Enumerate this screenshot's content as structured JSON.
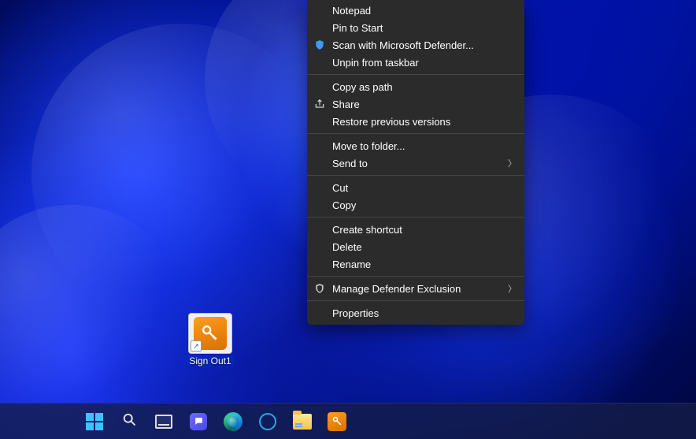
{
  "desktop": {
    "shortcut": {
      "label": "Sign Out1"
    }
  },
  "context_menu": {
    "groups": [
      [
        {
          "label": "Notepad",
          "icon": null,
          "submenu": false
        },
        {
          "label": "Pin to Start",
          "icon": null,
          "submenu": false
        },
        {
          "label": "Scan with Microsoft Defender...",
          "icon": "shield-icon",
          "submenu": false
        },
        {
          "label": "Unpin from taskbar",
          "icon": null,
          "submenu": false
        }
      ],
      [
        {
          "label": "Copy as path",
          "icon": null,
          "submenu": false
        },
        {
          "label": "Share",
          "icon": "share-icon",
          "submenu": false
        },
        {
          "label": "Restore previous versions",
          "icon": null,
          "submenu": false
        }
      ],
      [
        {
          "label": "Move to folder...",
          "icon": null,
          "submenu": false
        },
        {
          "label": "Send to",
          "icon": null,
          "submenu": true
        }
      ],
      [
        {
          "label": "Cut",
          "icon": null,
          "submenu": false
        },
        {
          "label": "Copy",
          "icon": null,
          "submenu": false
        }
      ],
      [
        {
          "label": "Create shortcut",
          "icon": null,
          "submenu": false
        },
        {
          "label": "Delete",
          "icon": null,
          "submenu": false
        },
        {
          "label": "Rename",
          "icon": null,
          "submenu": false
        }
      ],
      [
        {
          "label": "Manage Defender Exclusion",
          "icon": "defender-icon",
          "submenu": true
        }
      ],
      [
        {
          "label": "Properties",
          "icon": null,
          "submenu": false
        }
      ]
    ]
  },
  "taskbar": {
    "items": [
      {
        "name": "start-button",
        "icon": "start-icon"
      },
      {
        "name": "search-button",
        "icon": "search-icon"
      },
      {
        "name": "taskview-button",
        "icon": "taskview-icon"
      },
      {
        "name": "chat-button",
        "icon": "chat-icon"
      },
      {
        "name": "edge-button",
        "icon": "edge-icon"
      },
      {
        "name": "cortana-button",
        "icon": "cortana-icon"
      },
      {
        "name": "file-explorer-button",
        "icon": "folder-icon"
      },
      {
        "name": "signout-app-button",
        "icon": "key-icon"
      }
    ]
  },
  "colors": {
    "menu_bg": "#2b2b2b",
    "menu_fg": "#ffffff",
    "accent": "#3cc2ff"
  }
}
